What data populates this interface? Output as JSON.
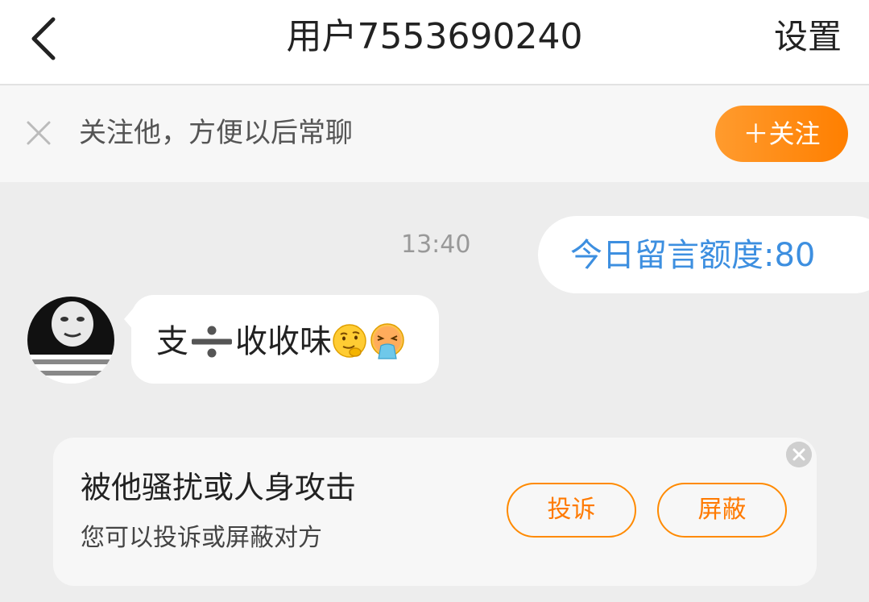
{
  "header": {
    "back_icon": "chevron-left-icon",
    "title": "用户7553690240",
    "settings": "设置"
  },
  "follow_bar": {
    "close_icon": "close-icon",
    "text": "关注他，方便以后常聊",
    "button": "＋关注",
    "accent": "#ff8a00"
  },
  "messages": [
    {
      "side": "right",
      "time": "13:40",
      "text": "今日留言额度:80",
      "color": "#3d8fe0"
    },
    {
      "side": "left",
      "avatar": "meme-avatar",
      "parts": [
        "支",
        "÷",
        "收收味"
      ],
      "emojis": [
        "thinking-face-icon",
        "vomiting-face-icon"
      ]
    }
  ],
  "report_card": {
    "title": "被他骚扰或人身攻击",
    "subtitle": "您可以投诉或屏蔽对方",
    "report": "投诉",
    "block": "屏蔽",
    "close_icon": "close-circle-icon"
  }
}
